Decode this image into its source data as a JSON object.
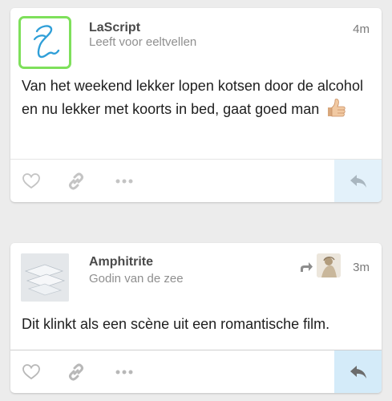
{
  "posts": [
    {
      "author": "LaScript",
      "handle": "Leeft voor eeltvellen",
      "time": "4m",
      "text": "Van het weekend lekker lopen kotsen door de alcohol en nu lekker met koorts in bed, gaat goed man",
      "emoji": "thumbs-up-icon",
      "avatar": "lascript-logo-avatar",
      "avatar_border_color": "#7ee05b",
      "reposted": false
    },
    {
      "author": "Amphitrite",
      "handle": "Godin van de zee",
      "time": "3m",
      "text": "Dit klinkt als een scène uit een romantische film.",
      "avatar": "photo-avatar",
      "reposted": true,
      "repost_icon": "repost-icon",
      "reposter_avatar": "reposter-avatar"
    }
  ],
  "actions": {
    "like_icon": "heart-icon",
    "link_icon": "link-icon",
    "more_icon": "more-icon",
    "reply_icon": "reply-icon"
  },
  "colors": {
    "background": "#ececec",
    "card": "#ffffff",
    "reply_bg": "#e3f1fa",
    "icon_gray": "#c4c4c4",
    "reply_icon": "#8a8a8a"
  }
}
